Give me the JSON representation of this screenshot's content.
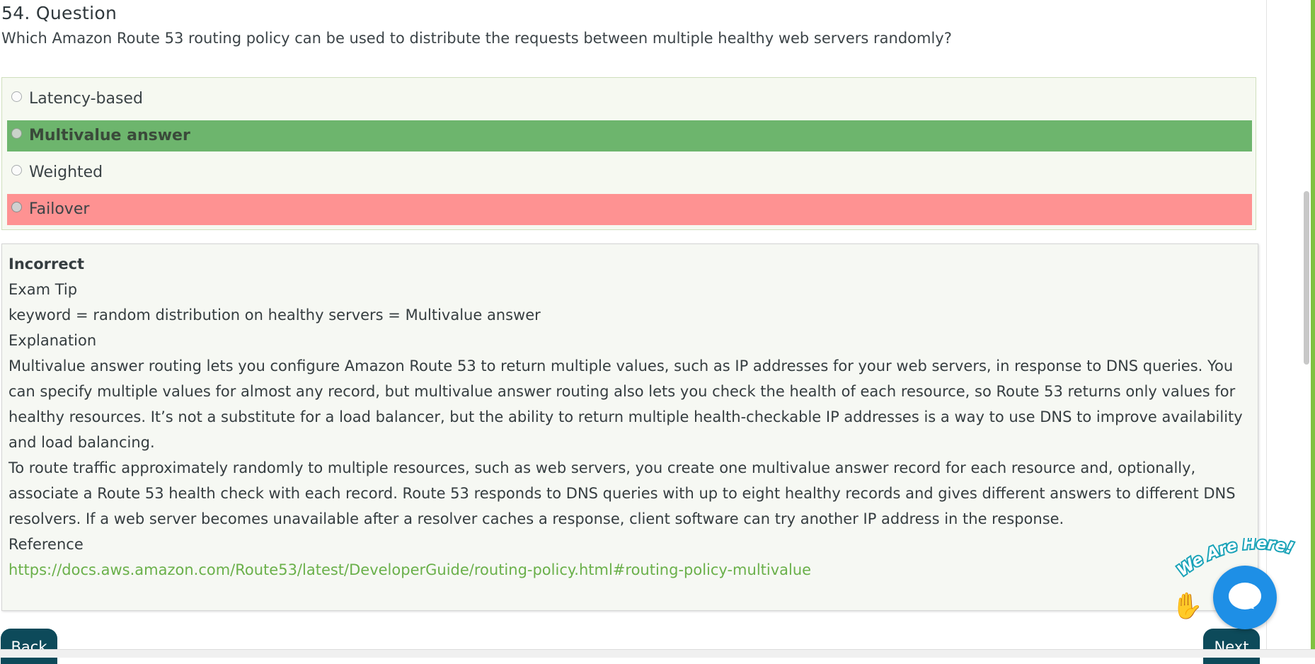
{
  "question": {
    "title": "54. Question",
    "text": "Which Amazon Route 53 routing policy can be used to distribute the requests between multiple healthy web servers randomly?"
  },
  "options": [
    {
      "label": "Latency-based",
      "state": "none"
    },
    {
      "label": "Multivalue answer",
      "state": "correct"
    },
    {
      "label": "Weighted",
      "state": "none"
    },
    {
      "label": "Failover",
      "state": "selected-wrong"
    }
  ],
  "explanation": {
    "status": "Incorrect",
    "tip_heading": "Exam Tip",
    "tip": "keyword = random distribution on healthy servers = Multivalue answer",
    "heading": "Explanation",
    "para1": "Multivalue answer routing lets you configure Amazon Route 53 to return multiple values, such as IP addresses for your web servers, in response to DNS queries. You can specify multiple values for almost any record, but multivalue answer routing also lets you check the health of each resource, so Route 53 returns only values for healthy resources. It’s not a substitute for a load balancer, but the ability to return multiple health-checkable IP addresses is a way to use DNS to improve availability and load balancing.",
    "para2": "To route traffic approximately randomly to multiple resources, such as web servers, you create one multivalue answer record for each resource and, optionally, associate a Route 53 health check with each record. Route 53 responds to DNS queries with up to eight healthy records and gives different answers to different DNS resolvers. If a web server becomes unavailable after a resolver caches a response, client software can try another IP address in the response.",
    "ref_heading": "Reference",
    "ref_link": "https://docs.aws.amazon.com/Route53/latest/DeveloperGuide/routing-policy.html#routing-policy-multivalue"
  },
  "nav": {
    "back": "Back",
    "next": "Next"
  },
  "chat": {
    "banner": "We Are Here!",
    "wave_icon": "waving-hand-icon"
  },
  "colors": {
    "correct": "#6db56d",
    "wrong": "#fe9292",
    "link": "#6ab04a",
    "button": "#0d4a5a",
    "chat": "#1e8fe6",
    "accent": "#7fc241"
  }
}
